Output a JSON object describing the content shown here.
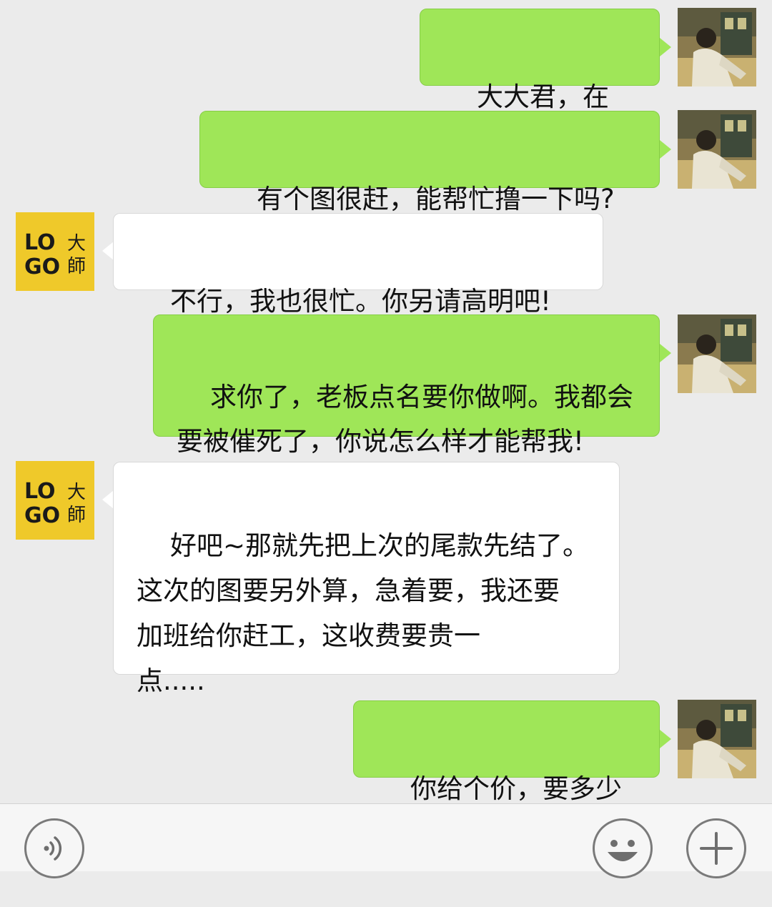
{
  "messages": [
    {
      "side": "me",
      "text": "大大君，在吗?"
    },
    {
      "side": "me",
      "text": "有个图很赶，能帮忙撸一下吗?"
    },
    {
      "side": "them",
      "text": "不行，我也很忙。你另请高明吧!"
    },
    {
      "side": "me",
      "text": "求你了，老板点名要你做啊。我都会\n要被催死了，你说怎么样才能帮我!"
    },
    {
      "side": "them",
      "text": "好吧~那就先把上次的尾款先结了。\n这次的图要另外算，急着要，我还要\n加班给你赶工，这收费要贵一\n点....."
    },
    {
      "side": "me",
      "text": "你给个价，要多少~"
    }
  ],
  "contact_logo": {
    "line1": "LO",
    "line2": "GO",
    "side_chars": "大師",
    "color": "#efc92a"
  },
  "input_bar": {
    "left_icon": "voice-icon",
    "emoji_icon": "emoji-icon",
    "plus_icon": "plus-icon"
  },
  "colors": {
    "my_bubble": "#9fe658",
    "their_bubble": "#ffffff",
    "background": "#ebebeb"
  }
}
